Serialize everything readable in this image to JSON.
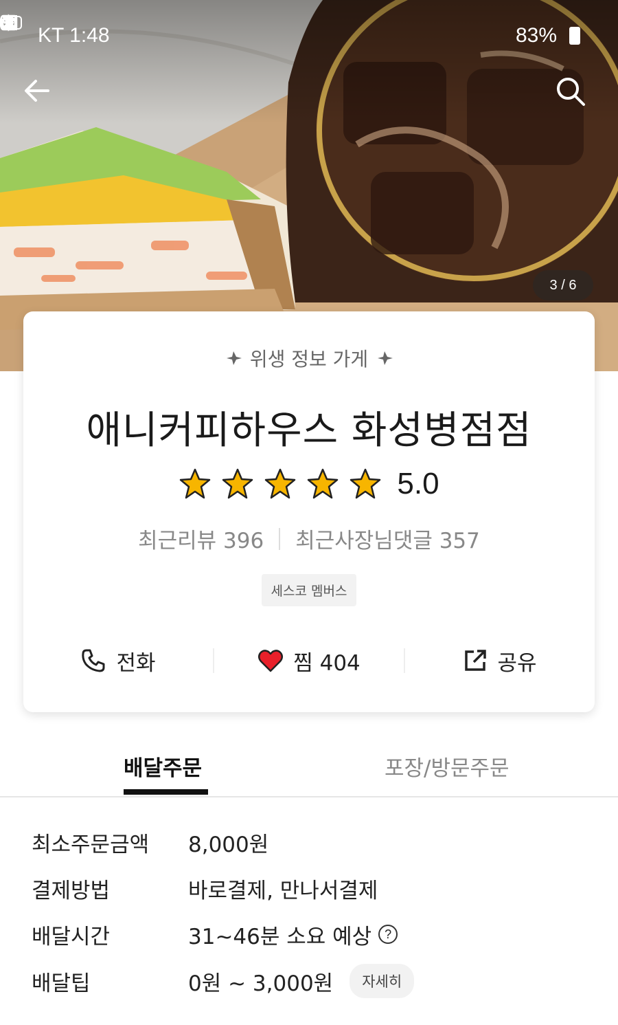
{
  "status_bar": {
    "carrier_time": "KT 1:48",
    "battery": "83%"
  },
  "hero": {
    "photo_counter": "3 / 6"
  },
  "store": {
    "hygiene_label": "위생 정보 가게",
    "name": "애니커피하우스 화성병점점",
    "rating": "5.0",
    "rating_stars": 5,
    "recent_reviews": "최근리뷰 396",
    "recent_owner_replies": "최근사장님댓글 357",
    "badge": "세스코 멤버스"
  },
  "actions": {
    "call_label": "전화",
    "favorite_label": "찜 404",
    "share_label": "공유"
  },
  "tabs": {
    "delivery": "배달주문",
    "pickup": "포장/방문주문"
  },
  "details": {
    "min_order_label": "최소주문금액",
    "min_order_value": "8,000원",
    "payment_label": "결제방법",
    "payment_value": "바로결제, 만나서결제",
    "delivery_time_label": "배달시간",
    "delivery_time_value": "31~46분 소요 예상",
    "delivery_tip_label": "배달팁",
    "delivery_tip_value": "0원 ~ 3,000원",
    "detail_button": "자세히"
  },
  "colors": {
    "star": "#f7b500",
    "heart": "#e8202a",
    "tab_active": "#111111"
  }
}
